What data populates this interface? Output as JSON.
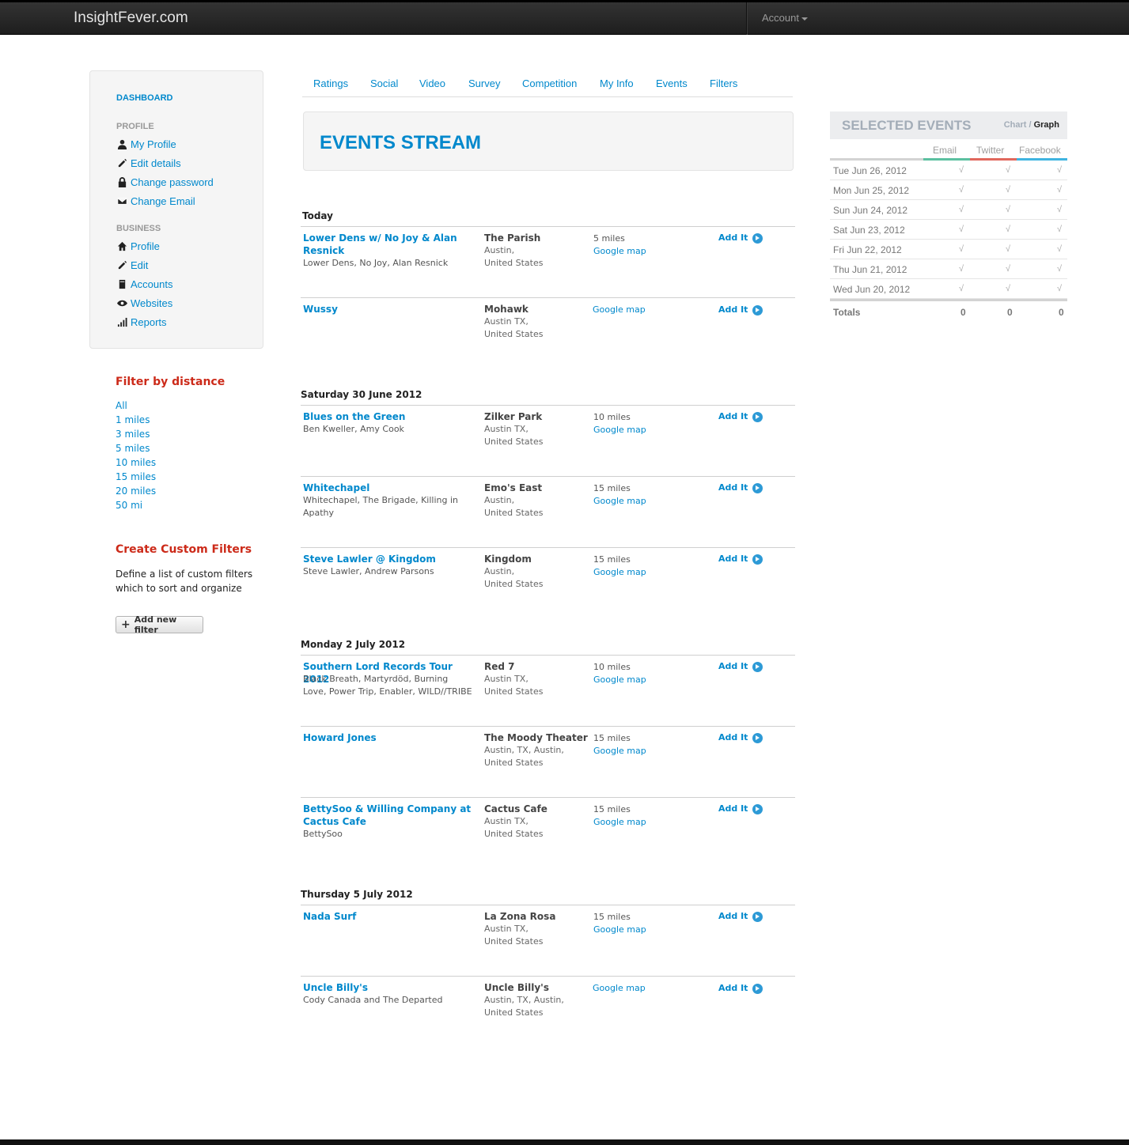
{
  "topbar": {
    "brand": "InsightFever.com",
    "account": "Account"
  },
  "sidebar": {
    "dashboard": "DASHBOARD",
    "profile_header": "PROFILE",
    "profile_items": [
      "My Profile",
      "Edit details",
      "Change password",
      "Change Email"
    ],
    "business_header": "BUSINESS",
    "business_items": [
      "Profile",
      "Edit",
      "Accounts",
      "Websites",
      "Reports"
    ],
    "filter_title": "Filter by distance",
    "distances": [
      "All",
      "1 miles",
      "3 miles",
      "5 miles",
      "10 miles",
      "15 miles",
      "20 miles",
      "50 mi"
    ],
    "custom_title": "Create Custom Filters",
    "custom_desc": "Define a list of custom filters which to sort and organize",
    "add_filter": "Add new filter"
  },
  "tabs": [
    "Ratings",
    "Social",
    "Video",
    "Survey",
    "Competition",
    "My Info",
    "Events",
    "Filters"
  ],
  "hero": {
    "title": "EVENTS STREAM"
  },
  "days": [
    {
      "label": "Today",
      "events": [
        {
          "title": "Lower Dens w/ No Joy & Alan Resnick",
          "artists": "Lower Dens, No Joy, Alan Resnick",
          "venue": "The Parish",
          "address": "Austin,\nUnited States",
          "miles": "5 miles",
          "map": "Google map",
          "add": "Add It"
        },
        {
          "title": "Wussy",
          "artists": "",
          "venue": "Mohawk",
          "address": "Austin TX,\nUnited States",
          "miles": "",
          "map": "Google map",
          "add": "Add It"
        }
      ]
    },
    {
      "label": "Saturday 30 June 2012",
      "events": [
        {
          "title": "Blues on the Green",
          "artists": "Ben Kweller, Amy Cook",
          "venue": "Zilker Park",
          "address": "Austin TX,\nUnited States",
          "miles": "10 miles",
          "map": "Google map",
          "add": "Add It"
        },
        {
          "title": "Whitechapel",
          "artists": "Whitechapel, The Brigade, Killing in Apathy",
          "venue": "Emo's East",
          "address": "Austin,\nUnited States",
          "miles": "15 miles",
          "map": "Google map",
          "add": "Add It"
        },
        {
          "title": "Steve Lawler @ Kingdom",
          "artists": "Steve Lawler, Andrew Parsons",
          "venue": "Kingdom",
          "address": "Austin,\nUnited States",
          "miles": "15 miles",
          "map": "Google map",
          "add": "Add It"
        }
      ]
    },
    {
      "label": "Monday 2 July 2012",
      "events": [
        {
          "title": "Southern Lord Records Tour 2012",
          "artists": "Black Breath, Martyrdöd, Burning Love, Power Trip, Enabler, WILD//TRIBE",
          "venue": "Red 7",
          "address": "Austin TX,\nUnited States",
          "miles": "10 miles",
          "map": "Google map",
          "add": "Add It"
        },
        {
          "title": "Howard Jones",
          "artists": "",
          "venue": "The Moody Theater",
          "address": "Austin, TX, Austin,\nUnited States",
          "miles": "15 miles",
          "map": "Google map",
          "add": "Add It"
        },
        {
          "title": "BettySoo & Willing Company at Cactus Cafe",
          "artists": "BettySoo",
          "venue": "Cactus Cafe",
          "address": "Austin TX,\nUnited States",
          "miles": "15 miles",
          "map": "Google map",
          "add": "Add It"
        }
      ]
    },
    {
      "label": "Thursday 5 July 2012",
      "events": [
        {
          "title": "Nada Surf",
          "artists": "",
          "venue": "La Zona Rosa",
          "address": "Austin TX,\nUnited States",
          "miles": "15 miles",
          "map": "Google map",
          "add": "Add It"
        },
        {
          "title": "Uncle Billy's",
          "artists": "Cody Canada and The Departed",
          "venue": "Uncle Billy's",
          "address": "Austin, TX, Austin,\nUnited States",
          "miles": "",
          "map": "Google map",
          "add": "Add It"
        }
      ]
    }
  ],
  "selected": {
    "title": "SELECTED EVENTS",
    "toggle_chart": "Chart /",
    "toggle_graph": "Graph",
    "columns": [
      "Email",
      "Twitter",
      "Facebook"
    ],
    "column_colors": [
      "#5bc0a0",
      "#e0675c",
      "#3fb4e0"
    ],
    "check": "√",
    "rows": [
      "Tue Jun 26, 2012",
      "Mon Jun 25, 2012",
      "Sun Jun 24, 2012",
      "Sat Jun 23, 2012",
      "Fri Jun 22, 2012",
      "Thu Jun 21, 2012",
      "Wed Jun 20, 2012"
    ],
    "totals_label": "Totals",
    "totals": [
      "0",
      "0",
      "0"
    ]
  },
  "icons": {
    "profile_items": [
      "user-icon",
      "pencil-icon",
      "lock-icon",
      "envelope-icon"
    ],
    "business_items": [
      "home-icon",
      "pencil-icon",
      "book-icon",
      "eye-icon",
      "signal-icon"
    ]
  }
}
